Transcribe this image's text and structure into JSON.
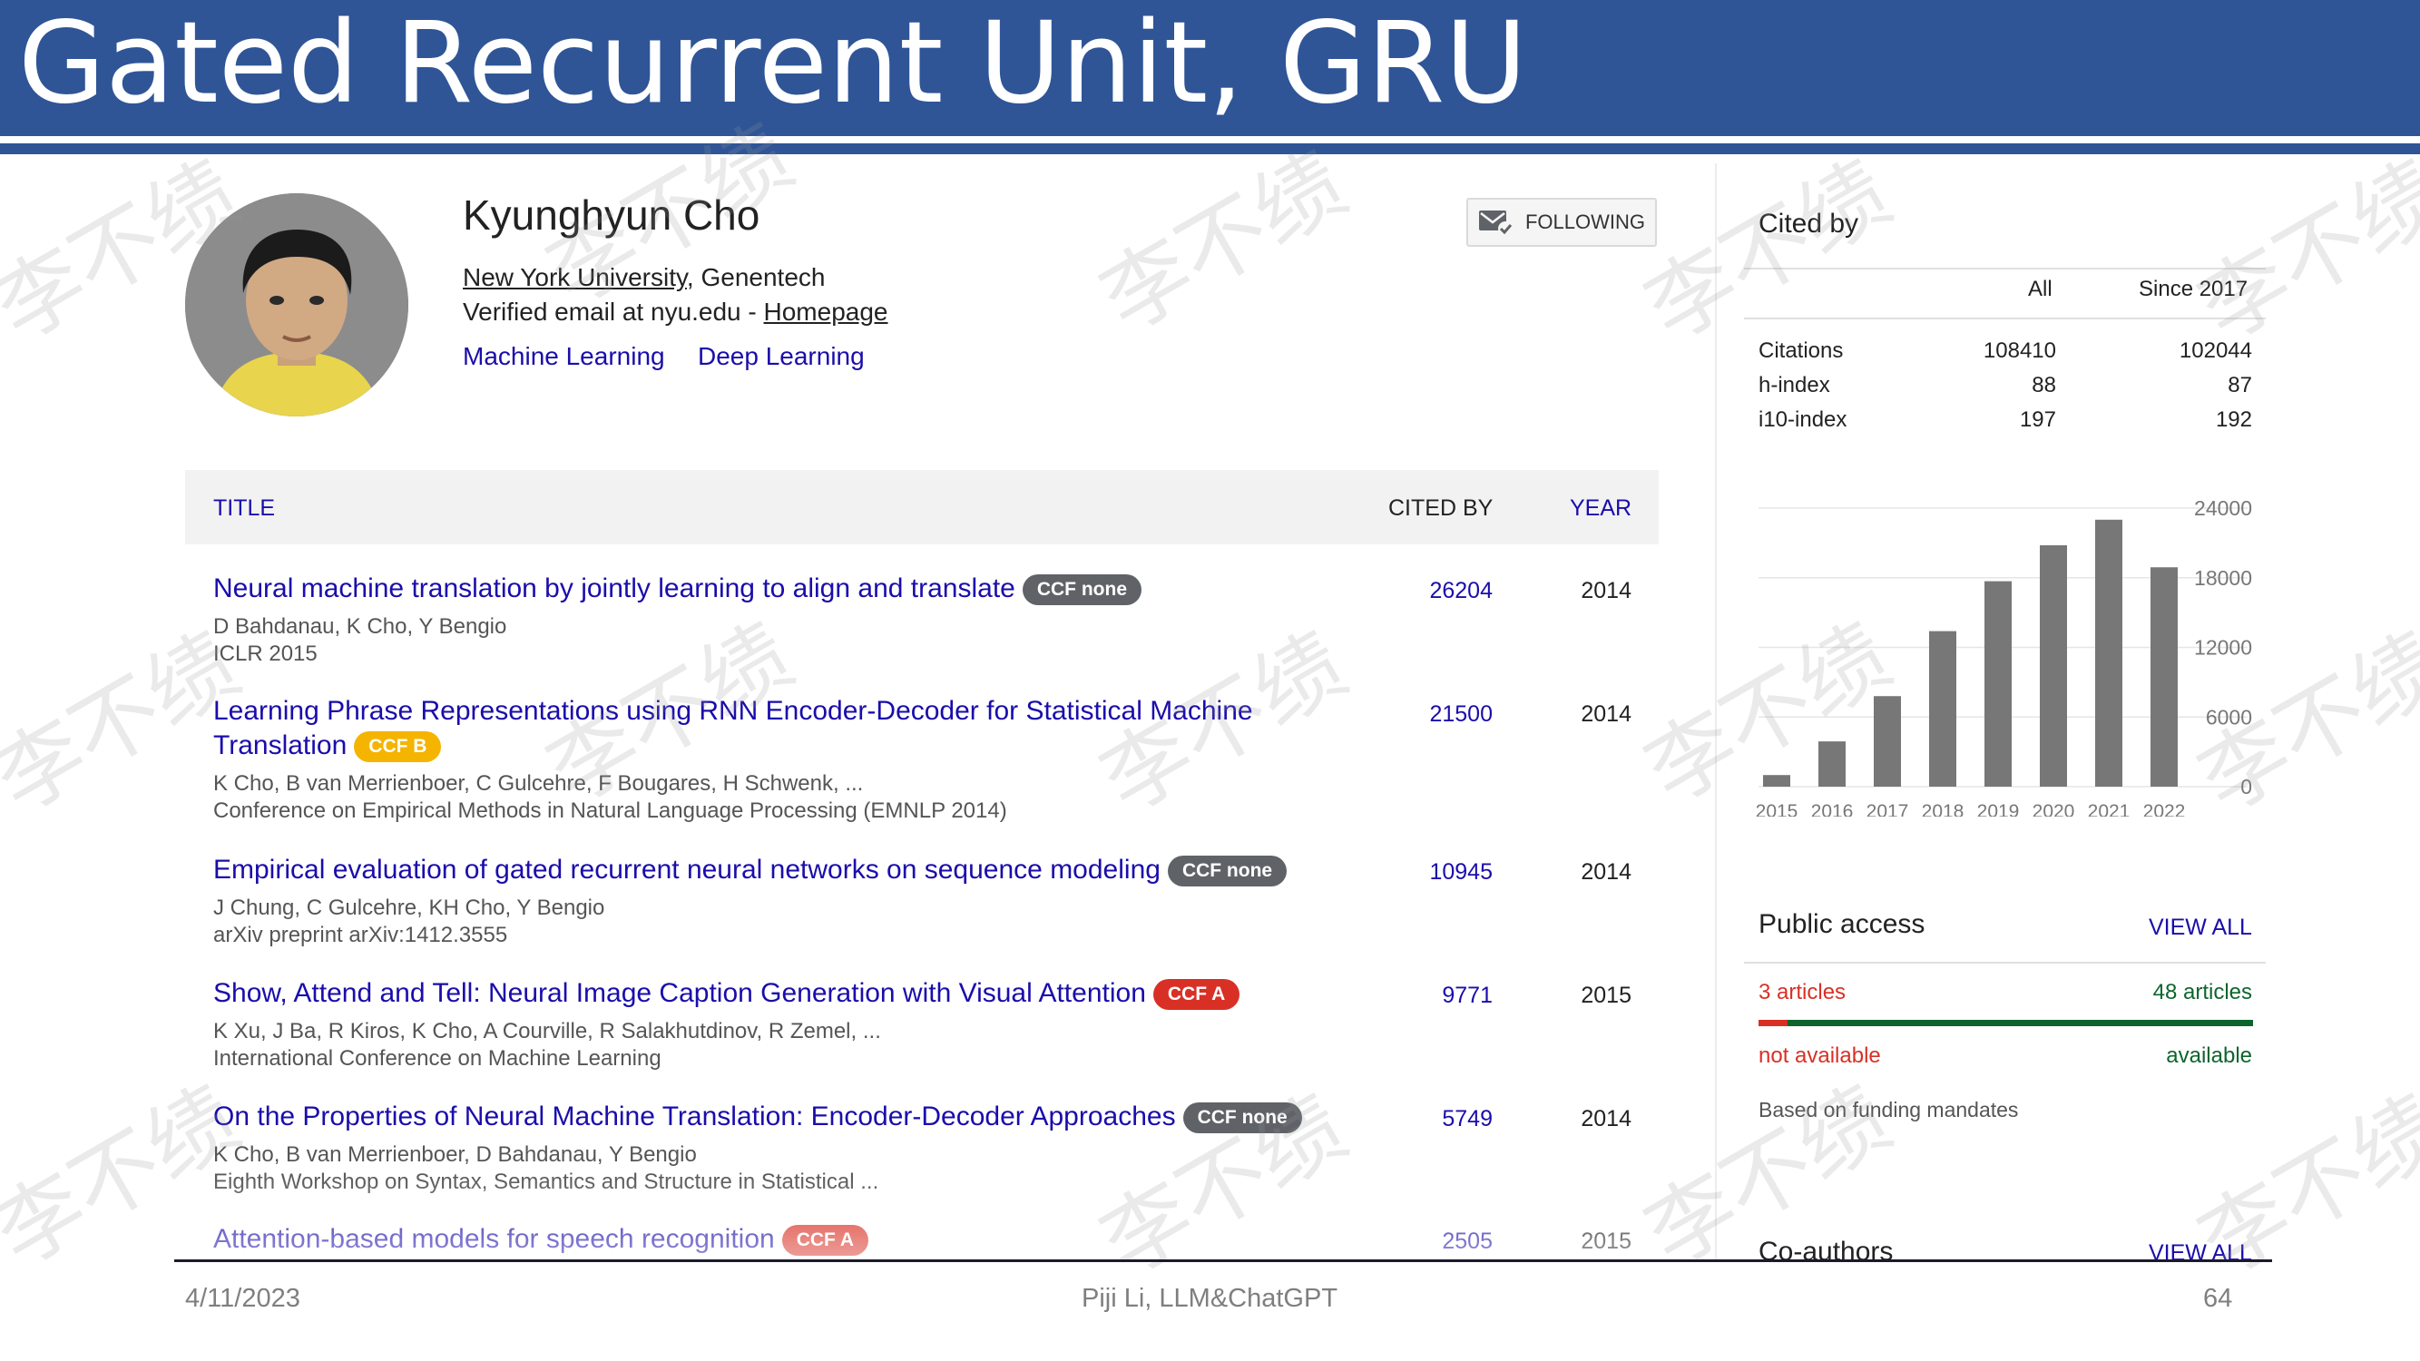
{
  "slide": {
    "title": "Gated Recurrent Unit, GRU",
    "footer_date": "4/11/2023",
    "footer_center": "Piji Li, LLM&ChatGPT",
    "footer_page": "64",
    "watermark": "李不绩"
  },
  "profile": {
    "name": "Kyunghyun Cho",
    "affiliation_link": "New York University",
    "affiliation_rest": ", Genentech",
    "email_text": "Verified email at nyu.edu - ",
    "homepage_link": "Homepage",
    "interests": [
      "Machine Learning",
      "Deep Learning"
    ],
    "follow_label": "FOLLOWING"
  },
  "table": {
    "col_title": "TITLE",
    "col_cited_by": "CITED BY",
    "col_year": "YEAR",
    "rows": [
      {
        "title": "Neural machine translation by jointly learning to align and translate",
        "ccf": "CCF none",
        "authors": "D Bahdanau, K Cho, Y Bengio",
        "venue": "ICLR 2015",
        "cited_by": "26204",
        "year": "2014"
      },
      {
        "title": "Learning Phrase Representations using RNN Encoder-Decoder for Statistical Machine Translation",
        "ccf": "CCF B",
        "authors": "K Cho, B van Merrienboer, C Gulcehre, F Bougares, H Schwenk, ...",
        "venue": "Conference on Empirical Methods in Natural Language Processing (EMNLP 2014)",
        "cited_by": "21500",
        "year": "2014"
      },
      {
        "title": "Empirical evaluation of gated recurrent neural networks on sequence modeling",
        "ccf": "CCF none",
        "authors": "J Chung, C Gulcehre, KH Cho, Y Bengio",
        "venue": "arXiv preprint arXiv:1412.3555",
        "cited_by": "10945",
        "year": "2014"
      },
      {
        "title": "Show, Attend and Tell: Neural Image Caption Generation with Visual Attention",
        "ccf": "CCF A",
        "authors": "K Xu, J Ba, R Kiros, K Cho, A Courville, R Salakhutdinov, R Zemel, ...",
        "venue": "International Conference on Machine Learning",
        "cited_by": "9771",
        "year": "2015"
      },
      {
        "title": "On the Properties of Neural Machine Translation: Encoder-Decoder Approaches",
        "ccf": "CCF none",
        "authors": "K Cho, B van Merrienboer, D Bahdanau, Y Bengio",
        "venue": "Eighth Workshop on Syntax, Semantics and Structure in Statistical ...",
        "cited_by": "5749",
        "year": "2014"
      },
      {
        "title": "Attention-based models for speech recognition",
        "ccf": "CCF A",
        "authors": "",
        "venue": "",
        "cited_by": "2505",
        "year": "2015"
      }
    ]
  },
  "ccf_colors": {
    "CCF none": "#5f6368",
    "CCF B": "#f4b400",
    "CCF A": "#d93025"
  },
  "cited_by": {
    "title": "Cited by",
    "col_all": "All",
    "col_since": "Since 2017",
    "rows": [
      {
        "label": "Citations",
        "all": "108410",
        "since": "102044"
      },
      {
        "label": "h-index",
        "all": "88",
        "since": "87"
      },
      {
        "label": "i10-index",
        "all": "197",
        "since": "192"
      }
    ]
  },
  "chart_data": {
    "type": "bar",
    "categories": [
      "2015",
      "2016",
      "2017",
      "2018",
      "2019",
      "2020",
      "2021",
      "2022"
    ],
    "values": [
      1000,
      3900,
      7800,
      13400,
      17700,
      20800,
      23000,
      18900
    ],
    "yticks": [
      "0",
      "6000",
      "12000",
      "18000",
      "24000"
    ],
    "ylim": [
      0,
      24000
    ],
    "bar_color": "#777777",
    "grid": true
  },
  "public_access": {
    "title": "Public access",
    "view_all": "VIEW ALL",
    "not_available_count": "3 articles",
    "available_count": "48 articles",
    "not_available_label": "not available",
    "available_label": "available",
    "mandates": "Based on funding mandates"
  },
  "coauthors": {
    "title": "Co-authors",
    "view_all": "VIEW ALL"
  }
}
